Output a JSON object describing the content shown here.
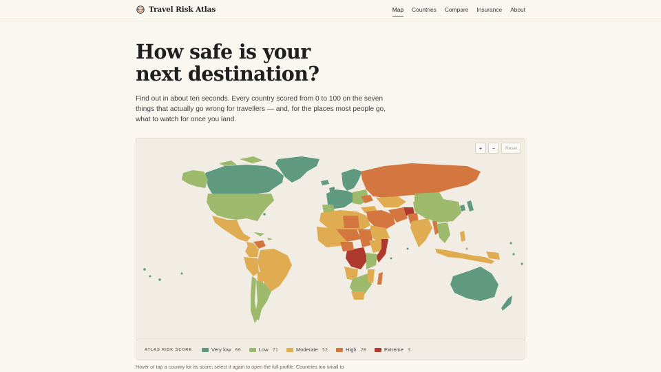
{
  "brand": {
    "name": "Travel Risk Atlas",
    "logo_icon": "globe-icon"
  },
  "nav": [
    {
      "label": "Map",
      "active": true
    },
    {
      "label": "Countries",
      "active": false
    },
    {
      "label": "Compare",
      "active": false
    },
    {
      "label": "Insurance",
      "active": false
    },
    {
      "label": "About",
      "active": false
    }
  ],
  "hero": {
    "headline_line1": "How safe is your",
    "headline_line2": "next destination?",
    "intro": "Find out in about ten seconds. Every country scored from 0 to 100 on the seven things that actually go wrong for travellers — and, for the places most people go, what to watch for once you land."
  },
  "map": {
    "zoom_in_label": "+",
    "zoom_out_label": "−",
    "reset_label": "Reset",
    "colors": {
      "very_low": "#5f9a80",
      "low": "#9dba6c",
      "moderate": "#e0ac52",
      "high": "#d4763f",
      "extreme": "#ad3a2c",
      "ocean": "#f2ede4"
    }
  },
  "legend": {
    "title": "ATLAS RISK SCORE",
    "items": [
      {
        "label": "Very low",
        "count": "66",
        "color": "#5f9a80"
      },
      {
        "label": "Low",
        "count": "71",
        "color": "#9dba6c"
      },
      {
        "label": "Moderate",
        "count": "52",
        "color": "#e0ac52"
      },
      {
        "label": "High",
        "count": "28",
        "color": "#d4763f"
      },
      {
        "label": "Extreme",
        "count": "3",
        "color": "#ad3a2c"
      }
    ]
  },
  "caption": "Hover or tap a country for its score; select it again to open the full profile. Countries too small to"
}
